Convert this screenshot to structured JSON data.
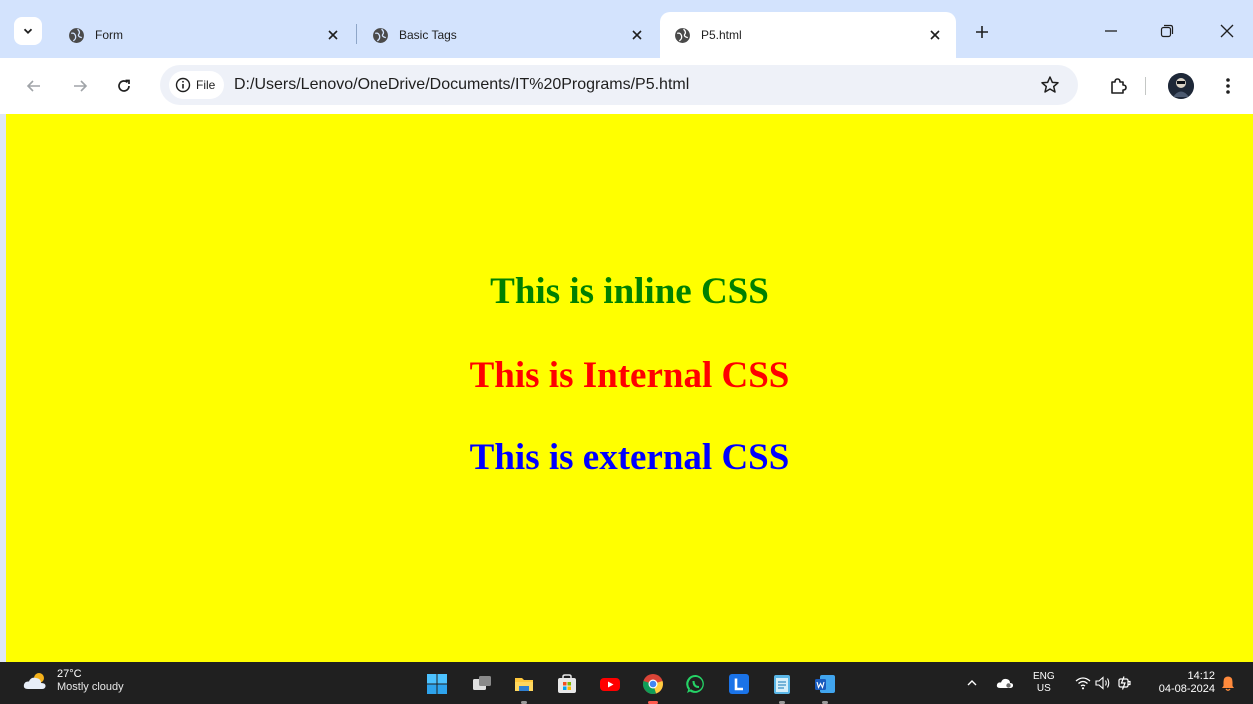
{
  "browser": {
    "tabs": [
      {
        "title": "Form",
        "active": false
      },
      {
        "title": "Basic Tags",
        "active": false
      },
      {
        "title": "P5.html",
        "active": true
      }
    ],
    "site_chip": "File",
    "url": "D:/Users/Lenovo/OneDrive/Documents/IT%20Programs/P5.html"
  },
  "page": {
    "background": "#ffff00",
    "headings": [
      {
        "text": "This is inline CSS",
        "color": "#008000"
      },
      {
        "text": "This is Internal CSS",
        "color": "#ff0000"
      },
      {
        "text": "This is external CSS",
        "color": "#0000ff"
      }
    ]
  },
  "taskbar": {
    "weather_temp": "27°C",
    "weather_condition": "Mostly cloudy",
    "apps": [
      "start-icon",
      "task-view-icon",
      "file-explorer-icon",
      "microsoft-store-icon",
      "youtube-icon",
      "chrome-icon",
      "whatsapp-icon",
      "l-app-icon",
      "notepad-icon",
      "word-icon"
    ],
    "lang_line1": "ENG",
    "lang_line2": "US",
    "time": "14:12",
    "date": "04-08-2024"
  }
}
